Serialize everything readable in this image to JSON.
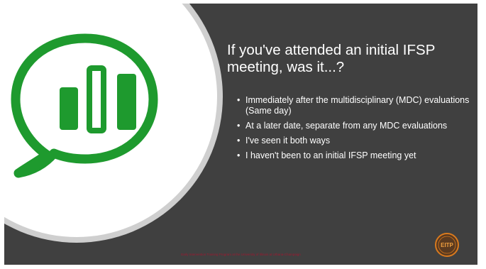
{
  "slide": {
    "title": "If you've attended an initial IFSP meeting, was it...?",
    "bullet_symbol": "•",
    "bullets": [
      "Immediately after the multidisciplinary (MDC) evaluations (Same day)",
      "At a later date, separate from any MDC evaluations",
      "I've seen it both ways",
      "I haven't been to an initial IFSP meeting yet"
    ],
    "footer": "Early Intervention Training Program at the University of Illinois at Urbana-Champaign",
    "logo_text": "EITP",
    "colors": {
      "background": "#404040",
      "icon_green": "#1e9a2e",
      "circle_ring": "#cfcfcf",
      "logo_orange": "#d97a1e",
      "footer_text": "#a01830"
    },
    "icons": [
      "poll-speech-bubble-icon",
      "eitp-logo-icon"
    ]
  }
}
